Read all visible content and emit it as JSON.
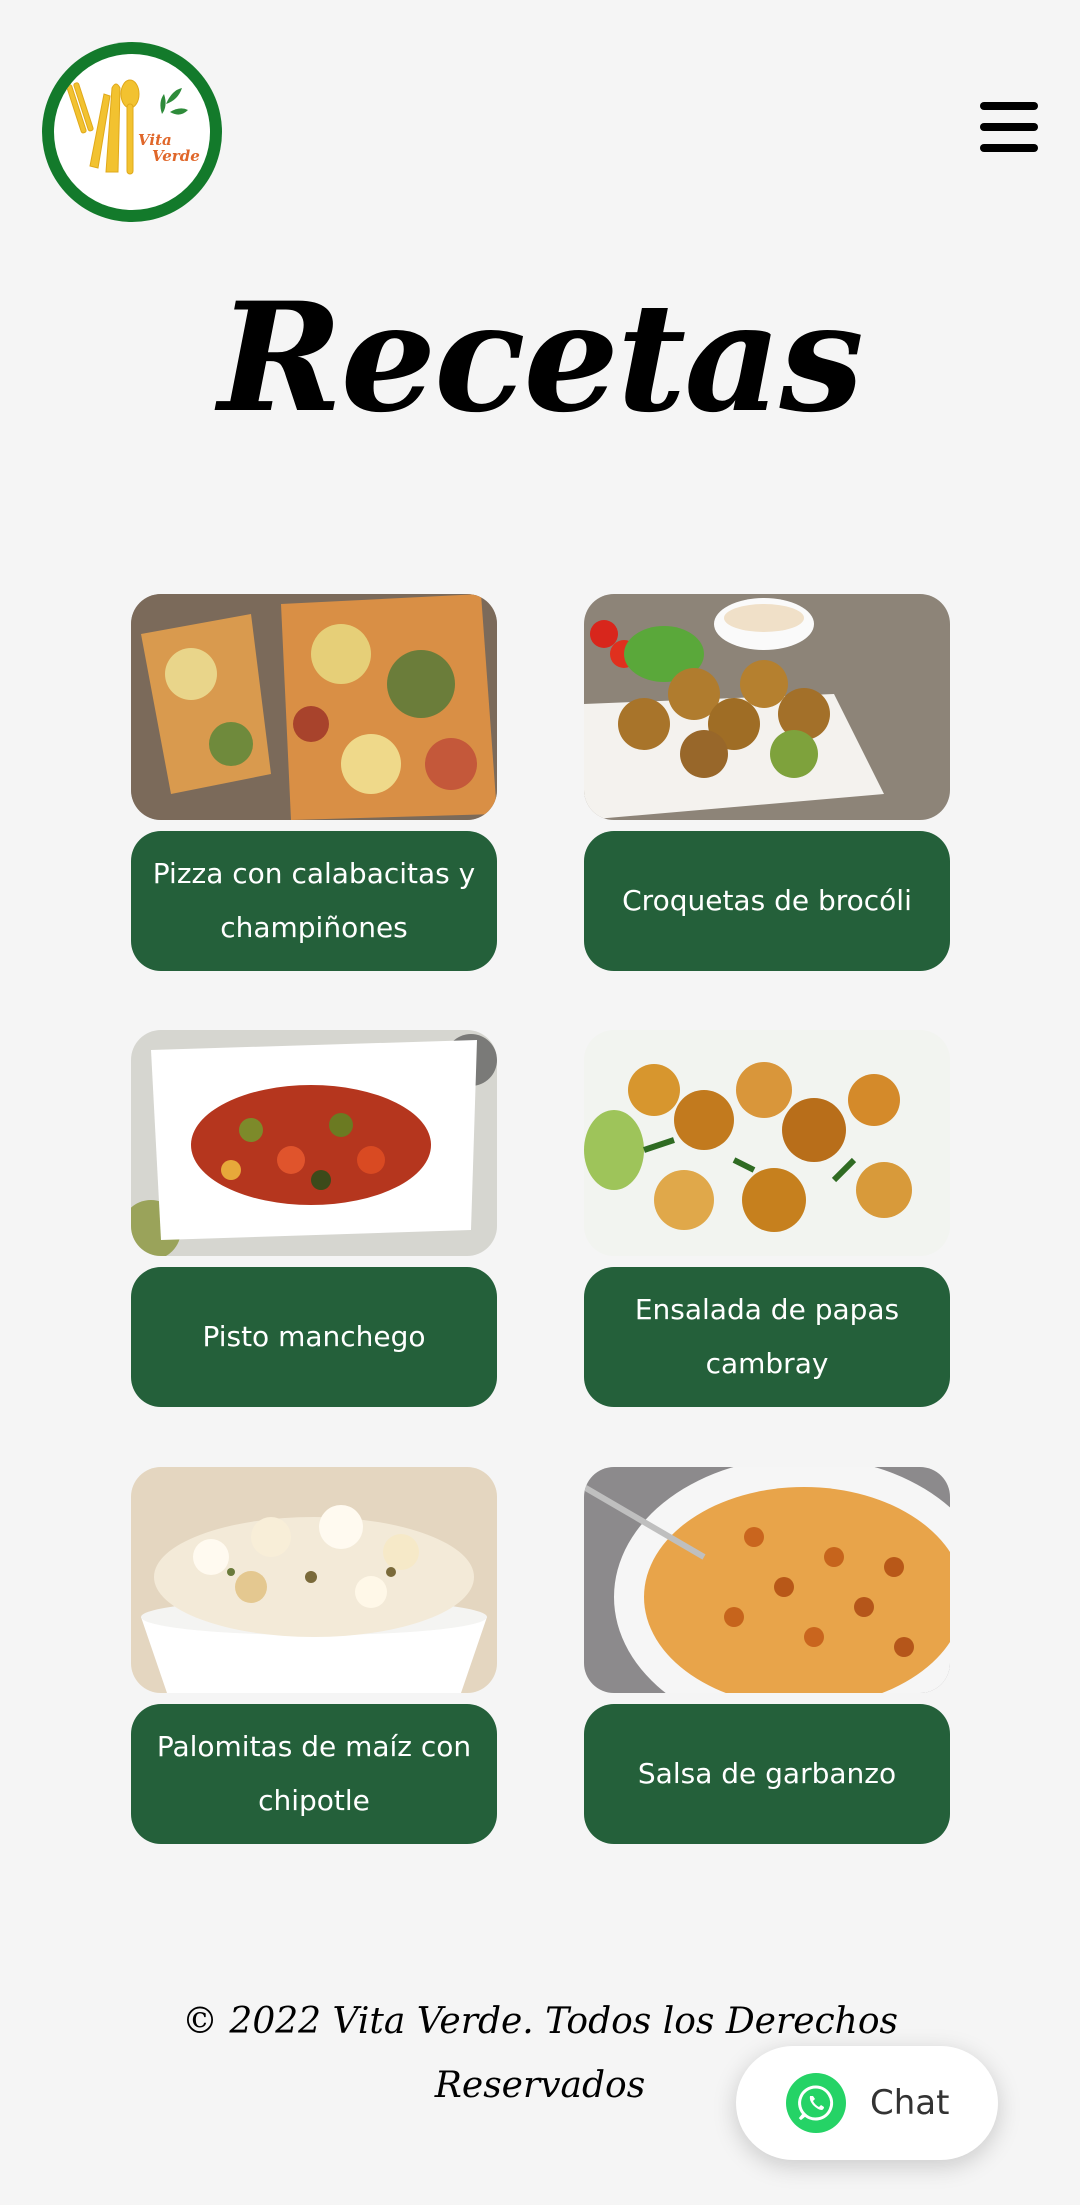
{
  "header": {
    "logo_text_line1": "Vita",
    "logo_text_line2": "Verde",
    "menu_icon": "hamburger-menu-icon"
  },
  "page": {
    "title": "Recetas"
  },
  "recipes": [
    {
      "label": "Pizza con calabacitas y champiñones",
      "image": "pizza-photo"
    },
    {
      "label": "Croquetas de brocóli",
      "image": "croquetas-photo"
    },
    {
      "label": "Pisto manchego",
      "image": "pisto-photo"
    },
    {
      "label": "Ensalada de papas cambray",
      "image": "papas-photo"
    },
    {
      "label": "Palomitas de maíz con chipotle",
      "image": "palomitas-photo"
    },
    {
      "label": "Salsa de garbanzo",
      "image": "garbanzo-photo"
    }
  ],
  "footer": {
    "copyright": "© 2022 Vita Verde. Todos los Derechos Reservados"
  },
  "chat": {
    "label": "Chat",
    "icon": "whatsapp-icon"
  },
  "colors": {
    "background": "#f5f5f5",
    "button_green": "#24603a",
    "logo_ring": "#137a2b",
    "whatsapp": "#25d366"
  }
}
